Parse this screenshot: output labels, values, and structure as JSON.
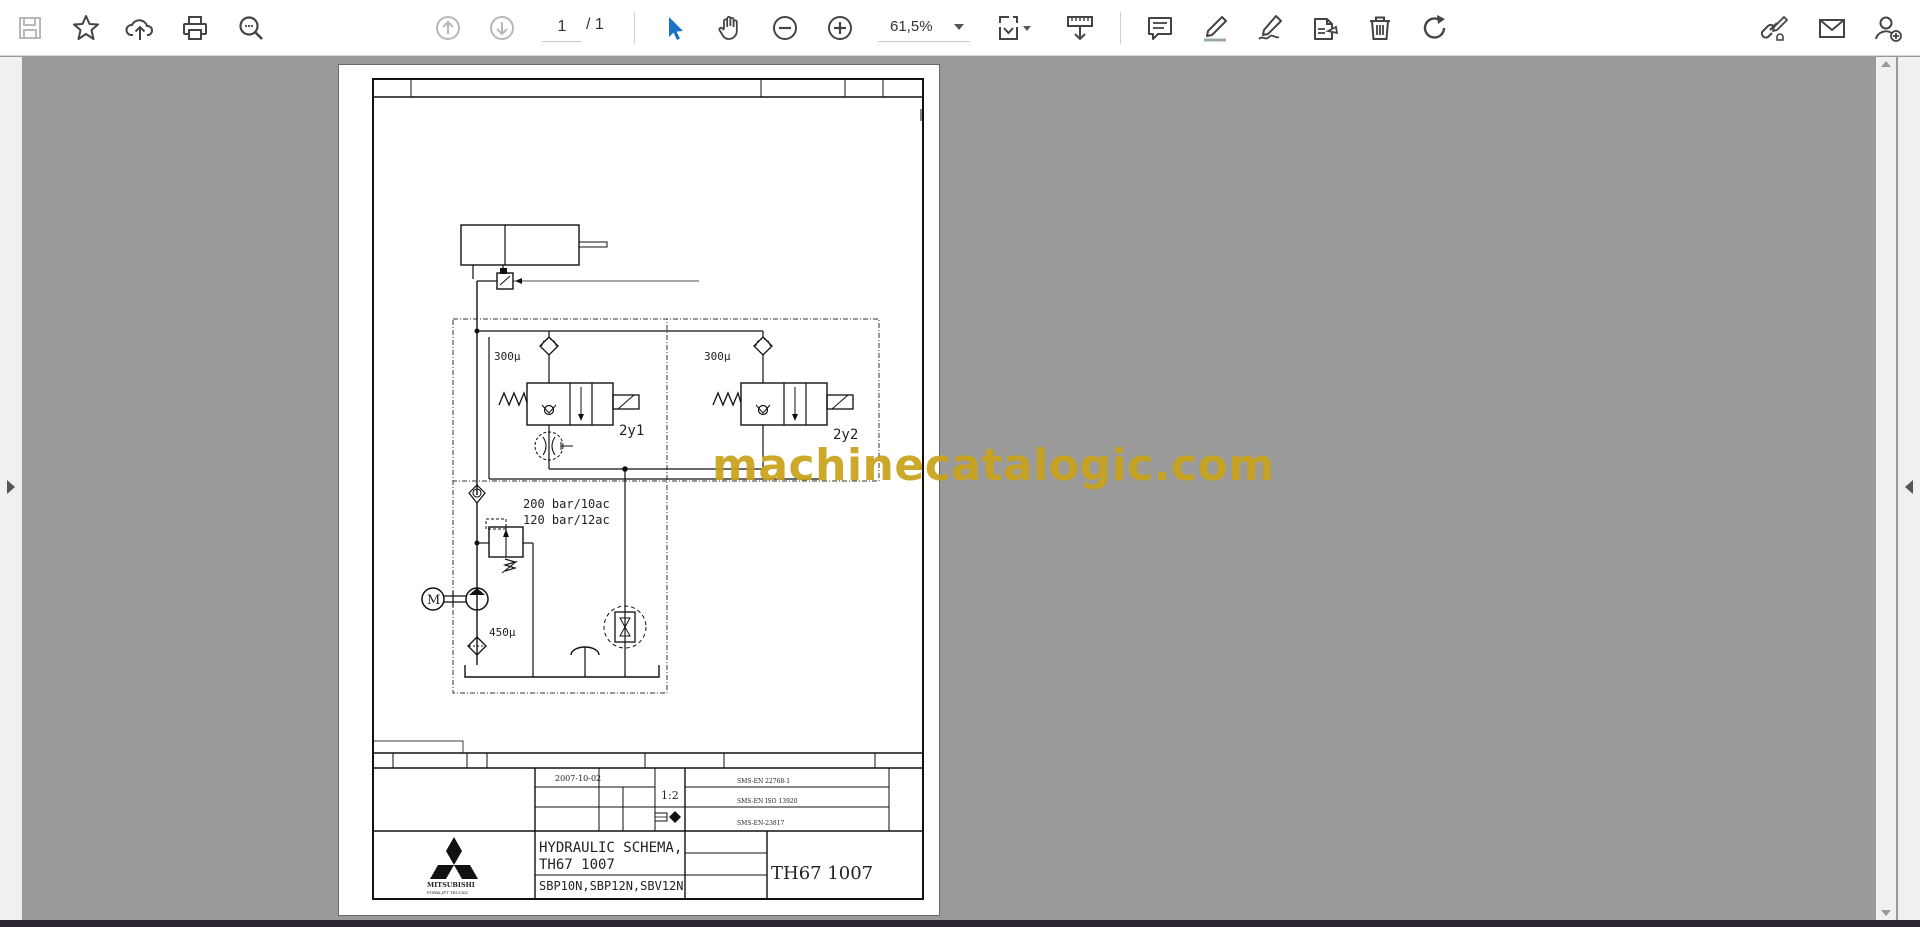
{
  "toolbar": {
    "page_current": "1",
    "page_total": "/ 1",
    "zoom": "61,5%",
    "colors": {
      "select_tool": "#1a73c8",
      "icon": "#444444",
      "icon_disabled": "#b8b8b8"
    },
    "icons": [
      "save-icon",
      "bookmark-star-icon",
      "upload-cloud-icon",
      "print-icon",
      "zoom-search-icon",
      "page-up-icon",
      "page-down-icon",
      "select-cursor-icon",
      "hand-pan-icon",
      "zoom-out-icon",
      "zoom-in-icon",
      "page-fit-icon",
      "scroll-mode-icon",
      "comment-icon",
      "highlight-pen-icon",
      "draw-pen-icon",
      "stamp-icon",
      "trash-icon",
      "rotate-icon",
      "edit-link-icon",
      "mail-icon",
      "share-user-icon"
    ]
  },
  "document": {
    "watermark": "machinecatalogic.com",
    "drawing": {
      "filter_left": "300µ",
      "filter_right": "300µ",
      "solenoid_left": "2y1",
      "solenoid_right": "2y2",
      "pressure_1": "200 bar/10ac",
      "pressure_2": "120 bar/12ac",
      "motor": "M",
      "suction_filter": "450µ"
    },
    "title_block": {
      "date": "2007-10-02",
      "scale": "1:2",
      "ref_1": "SMS-EN 22768-1",
      "ref_2": "SMS-EN ISO 13920",
      "ref_3": "SMS-EN-23817",
      "title_line1": "HYDRAULIC SCHEMA,",
      "title_line2": "TH67 1007",
      "models": "SBP10N,SBP12N,SBV12N",
      "drawing_number": "TH67 1007",
      "company": "MITSUBISHI",
      "company_sub": "FORKLIFT TRUCKS"
    }
  }
}
